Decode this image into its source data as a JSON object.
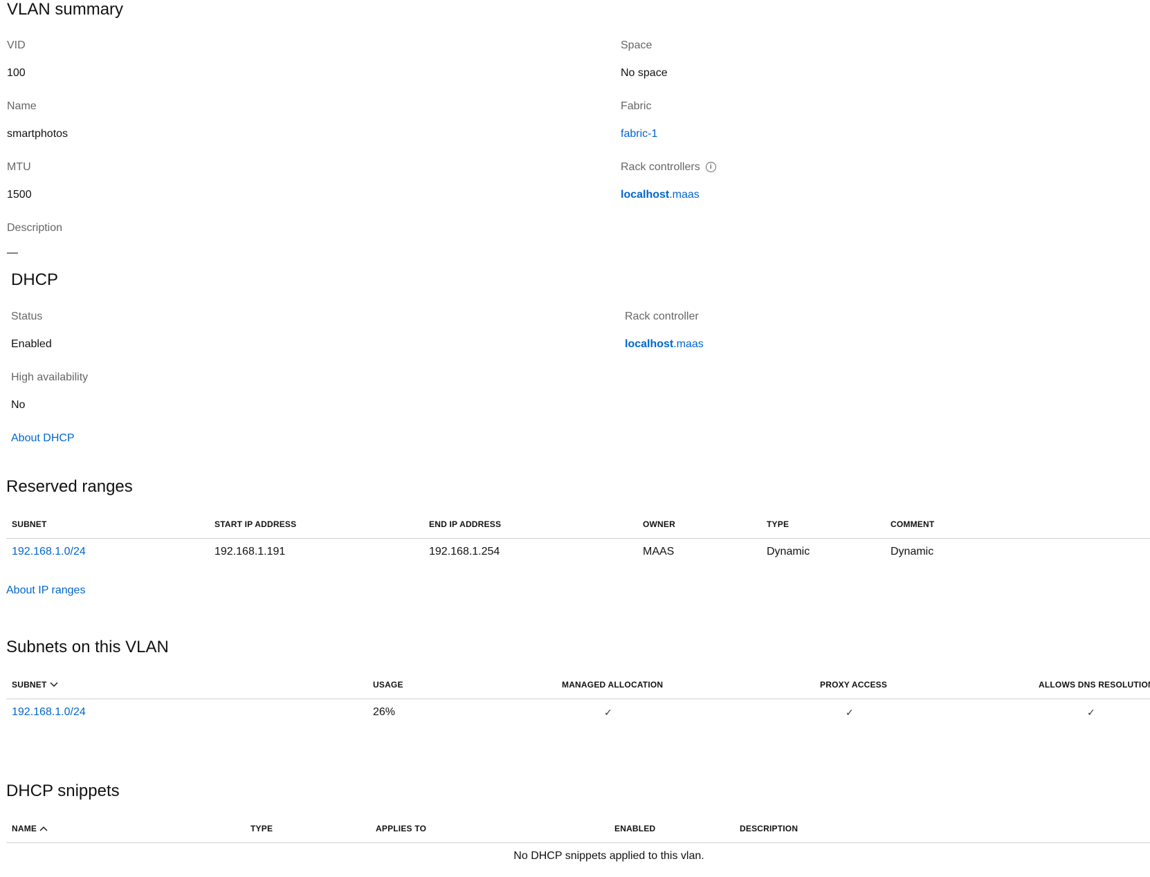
{
  "vlan_summary": {
    "title": "VLAN summary",
    "vid_label": "VID",
    "vid_value": "100",
    "name_label": "Name",
    "name_value": "smartphotos",
    "mtu_label": "MTU",
    "mtu_value": "1500",
    "description_label": "Description",
    "description_value": "—",
    "space_label": "Space",
    "space_value": "No space",
    "fabric_label": "Fabric",
    "fabric_value": "fabric-1",
    "rack_controllers_label": "Rack controllers",
    "rack_host_bold": "localhost",
    "rack_host_domain": ".maas"
  },
  "dhcp": {
    "title": "DHCP",
    "status_label": "Status",
    "status_value": "Enabled",
    "ha_label": "High availability",
    "ha_value": "No",
    "about_link": "About DHCP",
    "rack_controller_label": "Rack controller",
    "rack_host_bold": "localhost",
    "rack_host_domain": ".maas"
  },
  "reserved_ranges": {
    "title": "Reserved ranges",
    "columns": [
      "SUBNET",
      "START IP ADDRESS",
      "END IP ADDRESS",
      "OWNER",
      "TYPE",
      "COMMENT"
    ],
    "rows": [
      {
        "subnet": "192.168.1.0/24",
        "start": "192.168.1.191",
        "end": "192.168.1.254",
        "owner": "MAAS",
        "type": "Dynamic",
        "comment": "Dynamic"
      }
    ],
    "about_link": "About IP ranges"
  },
  "subnets": {
    "title": "Subnets on this VLAN",
    "columns": [
      "SUBNET",
      "USAGE",
      "MANAGED ALLOCATION",
      "PROXY ACCESS",
      "ALLOWS DNS RESOLUTION"
    ],
    "rows": [
      {
        "subnet": "192.168.1.0/24",
        "usage": "26%",
        "managed": "✓",
        "proxy": "✓",
        "dns": "✓"
      }
    ]
  },
  "dhcp_snippets": {
    "title": "DHCP snippets",
    "columns": [
      "NAME",
      "TYPE",
      "APPLIES TO",
      "ENABLED",
      "DESCRIPTION"
    ],
    "empty_message": "No DHCP snippets applied to this vlan."
  },
  "colors": {
    "link": "#0066cc",
    "label": "#666666",
    "divider": "#cfcfcf"
  }
}
